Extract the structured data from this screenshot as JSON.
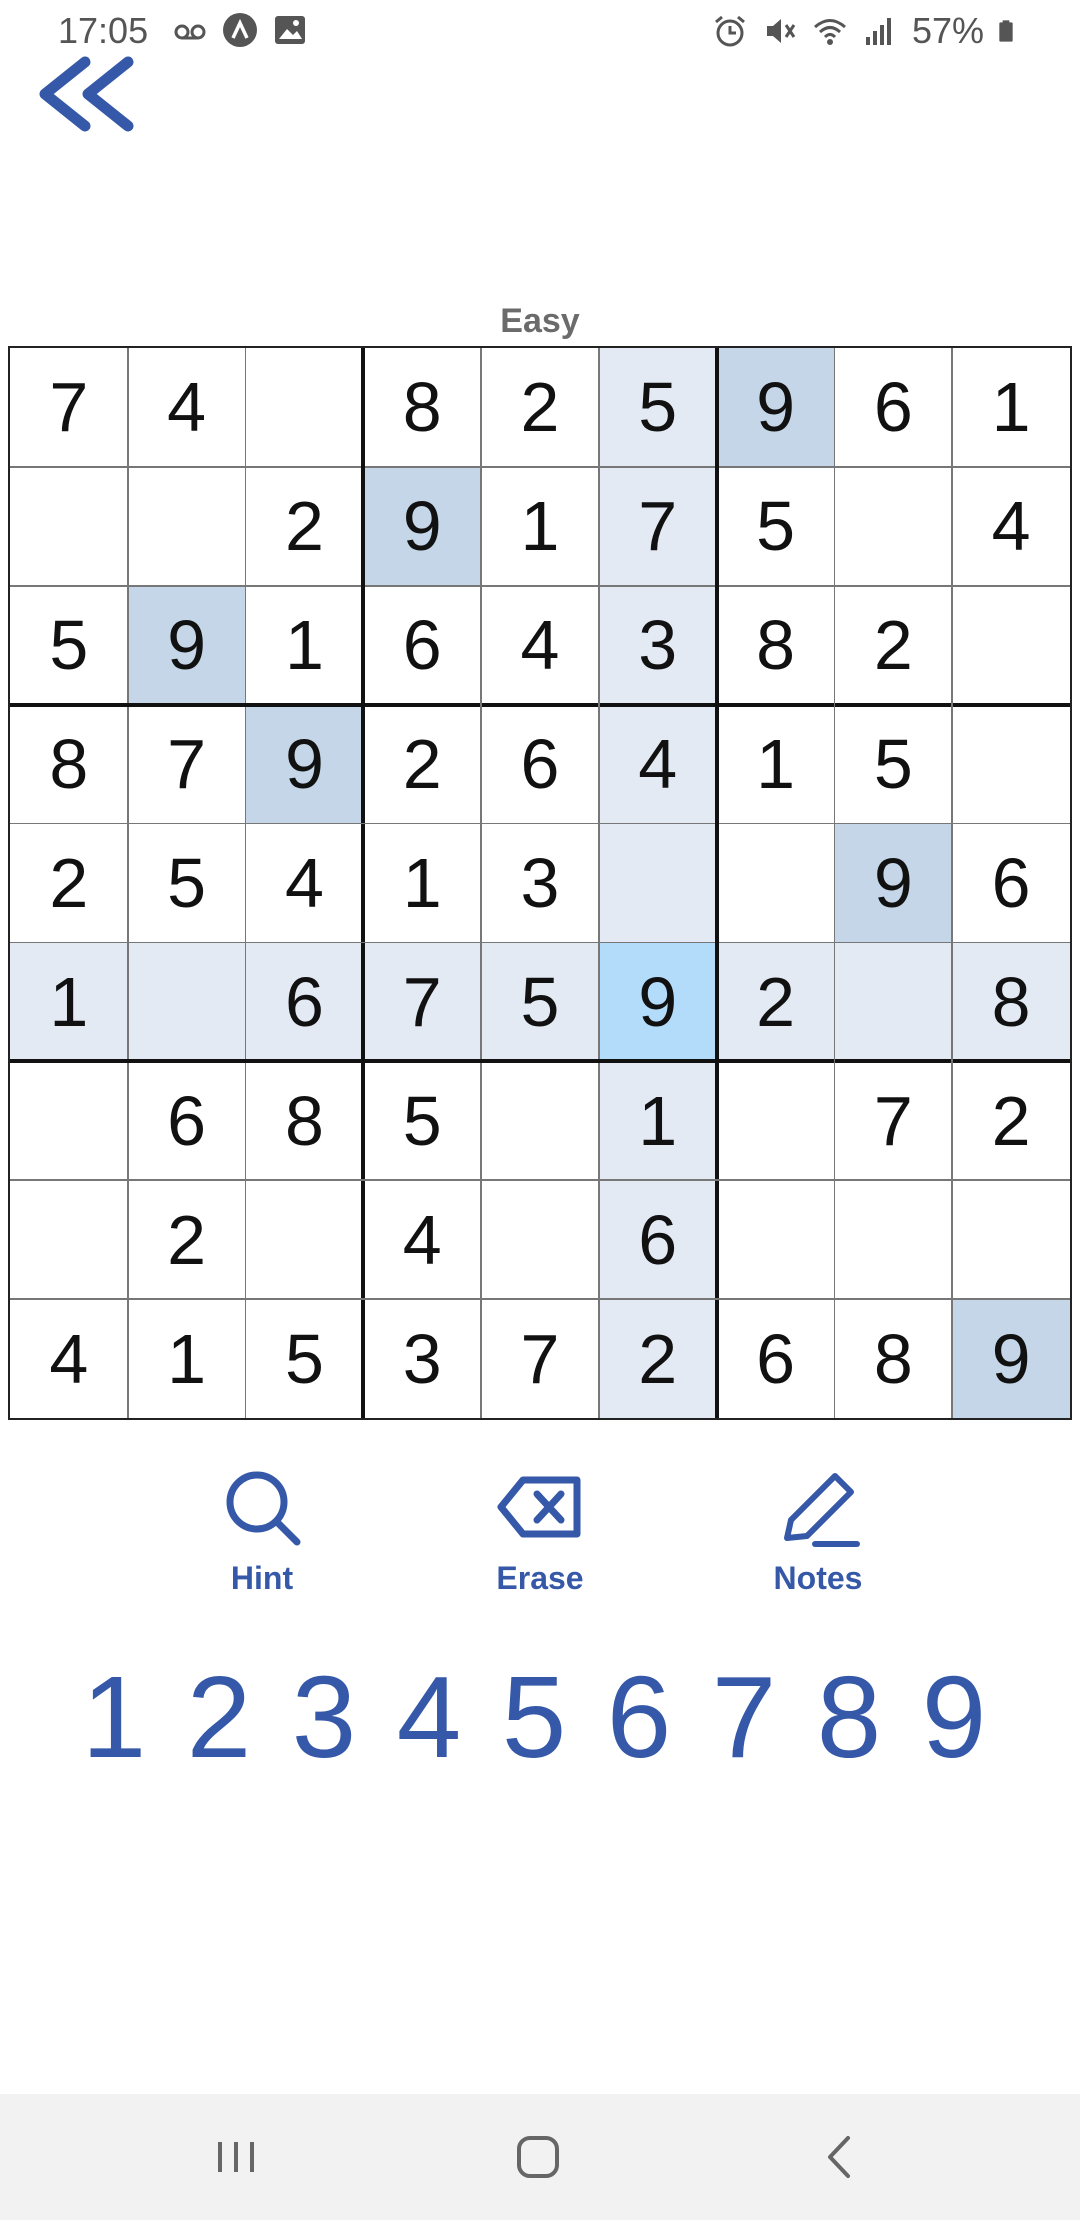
{
  "status_bar": {
    "time": "17:05",
    "battery": "57%",
    "left_icons": [
      "voicemail-icon",
      "app-notification-icon",
      "image-icon"
    ],
    "right_icons": [
      "alarm-icon",
      "mute-icon",
      "wifi-icon",
      "signal-icon",
      "battery-icon"
    ]
  },
  "header": {
    "back_icon": "double-chevron-left-icon"
  },
  "game": {
    "difficulty": "Easy",
    "selected_cell": {
      "row": 6,
      "col": 6,
      "value": 9
    },
    "board": [
      [
        "7",
        "4",
        "",
        "8",
        "2",
        "5",
        "9",
        "6",
        "1"
      ],
      [
        "",
        "",
        "2",
        "9",
        "1",
        "7",
        "5",
        "",
        "4"
      ],
      [
        "5",
        "9",
        "1",
        "6",
        "4",
        "3",
        "8",
        "2",
        ""
      ],
      [
        "8",
        "7",
        "9",
        "2",
        "6",
        "4",
        "1",
        "5",
        ""
      ],
      [
        "2",
        "5",
        "4",
        "1",
        "3",
        "",
        "",
        "9",
        "6"
      ],
      [
        "1",
        "",
        "6",
        "7",
        "5",
        "9",
        "2",
        "",
        "8"
      ],
      [
        "",
        "6",
        "8",
        "5",
        "",
        "1",
        "",
        "7",
        "2"
      ],
      [
        "",
        "2",
        "",
        "4",
        "",
        "6",
        "",
        "",
        ""
      ],
      [
        "4",
        "1",
        "5",
        "3",
        "7",
        "2",
        "6",
        "8",
        "9"
      ]
    ]
  },
  "tools": [
    {
      "label": "Hint",
      "icon": "search-icon"
    },
    {
      "label": "Erase",
      "icon": "backspace-icon"
    },
    {
      "label": "Notes",
      "icon": "pencil-icon"
    }
  ],
  "numpad": [
    "1",
    "2",
    "3",
    "4",
    "5",
    "6",
    "7",
    "8",
    "9"
  ],
  "colors": {
    "accent": "#3558a8",
    "related_highlight": "#e3eaf4",
    "same_number_highlight": "#c4d6e8",
    "selected_cell": "#b3dcfb",
    "nav_background": "#f2f2f2"
  },
  "nav_bar": {
    "buttons": [
      "recents-icon",
      "home-icon",
      "back-icon"
    ]
  }
}
